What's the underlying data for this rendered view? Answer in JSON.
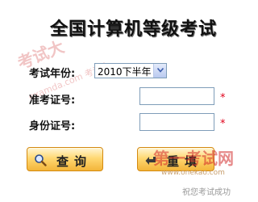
{
  "title": "全国计算机等级考试",
  "watermarks": {
    "top_brand": "考试大",
    "top_url": "examda.com 考试大",
    "bottom_brand": "第一考试网",
    "bottom_url": "www.onekao.com",
    "bottom_slogan": "祝您考试成功"
  },
  "form": {
    "year_label": "考试年份:",
    "year_value": "2010下半年",
    "ticket_label": "准考证号:",
    "ticket_value": "",
    "id_label": "身份证号:",
    "id_value": "",
    "required_mark": "*"
  },
  "buttons": {
    "query_label": "查询",
    "reset_label": "重填"
  },
  "colors": {
    "button_fill": "#ffd873",
    "button_border": "#d4890f",
    "required": "#e0001a"
  },
  "icons": {
    "query": "magnifier-icon",
    "reset": "arrow-left-icon",
    "dropdown": "chevron-down-icon"
  }
}
